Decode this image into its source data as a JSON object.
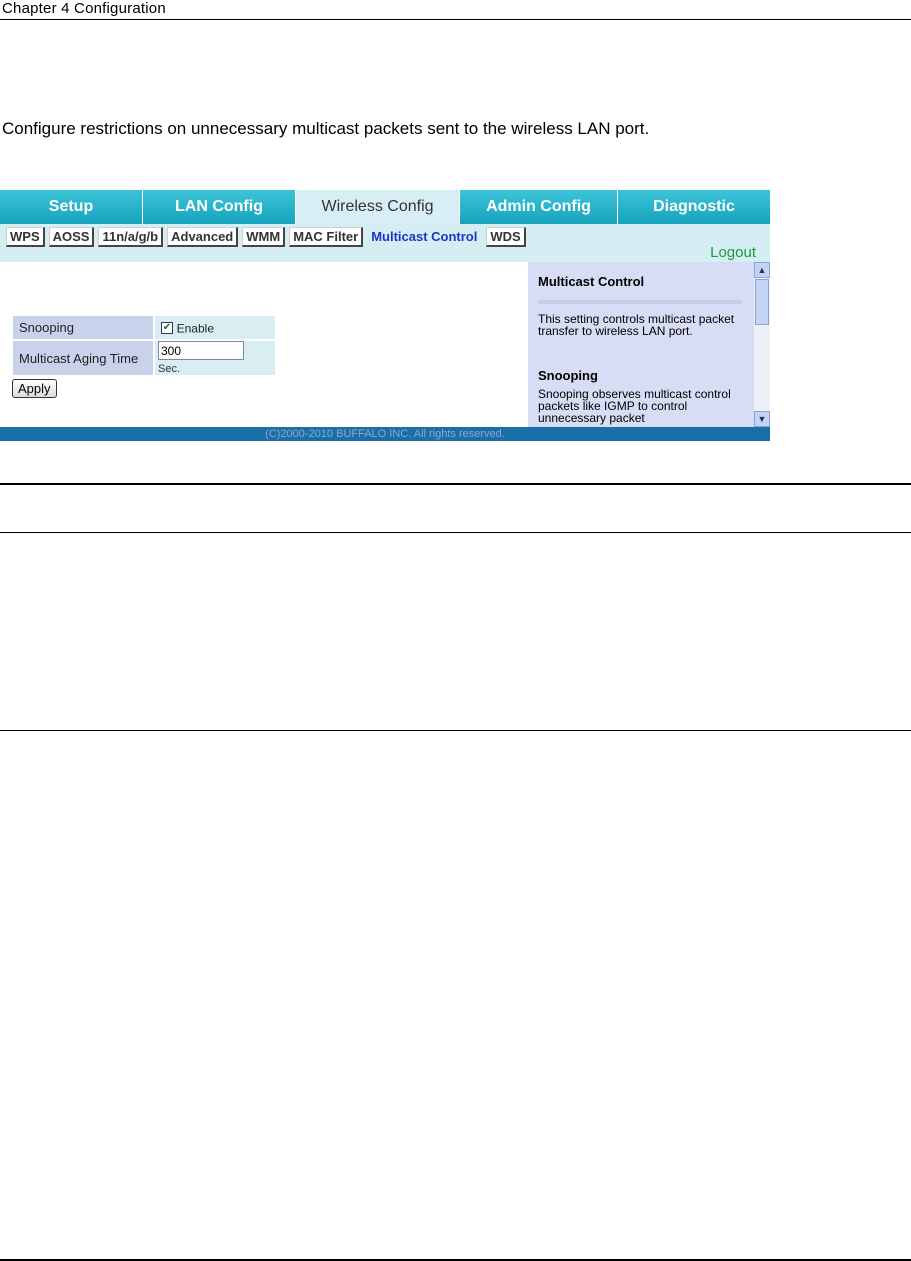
{
  "document": {
    "chapter": "Chapter 4  Configuration",
    "intro": "Configure restrictions on unnecessary multicast packets sent to the wireless LAN port."
  },
  "router_ui": {
    "top_tabs": [
      {
        "label": "Setup",
        "active": false
      },
      {
        "label": "LAN Config",
        "active": false
      },
      {
        "label": "Wireless Config",
        "active": true
      },
      {
        "label": "Admin Config",
        "active": false
      },
      {
        "label": "Diagnostic",
        "active": false
      }
    ],
    "sub_tabs": [
      {
        "label": "WPS",
        "active": false
      },
      {
        "label": "AOSS",
        "active": false
      },
      {
        "label": "11n/a/g/b",
        "active": false
      },
      {
        "label": "Advanced",
        "active": false
      },
      {
        "label": "WMM",
        "active": false
      },
      {
        "label": "MAC Filter",
        "active": false
      },
      {
        "label": "Multicast Control",
        "active": true
      },
      {
        "label": "WDS",
        "active": false
      }
    ],
    "logout": "Logout",
    "settings": {
      "snooping_label": "Snooping",
      "snooping_checked": true,
      "snooping_check_glyph": "✔",
      "enable_label": "Enable",
      "aging_label": "Multicast Aging Time",
      "aging_value": "300",
      "aging_unit": "Sec."
    },
    "apply_label": "Apply",
    "help": {
      "title": "Multicast Control",
      "text": "This setting controls multicast packet transfer to wireless LAN port.",
      "snooping_heading": "Snooping",
      "snooping_text": "Snooping observes multicast control packets like IGMP to control unnecessary packet"
    },
    "scroll": {
      "up_glyph": "▲",
      "down_glyph": "▼"
    },
    "footer": "(C)2000-2010 BUFFALO INC. All rights reserved.",
    "colors": {
      "nav_tab": "#17a3bd",
      "nav_active": "#d6eef4",
      "subnav_bg": "#d5eef3",
      "active_subtab_text": "#1a36c8",
      "logout": "#1e9a3c",
      "help_bg": "#d8ddf6",
      "footer_bg": "#1b6fa8"
    }
  }
}
